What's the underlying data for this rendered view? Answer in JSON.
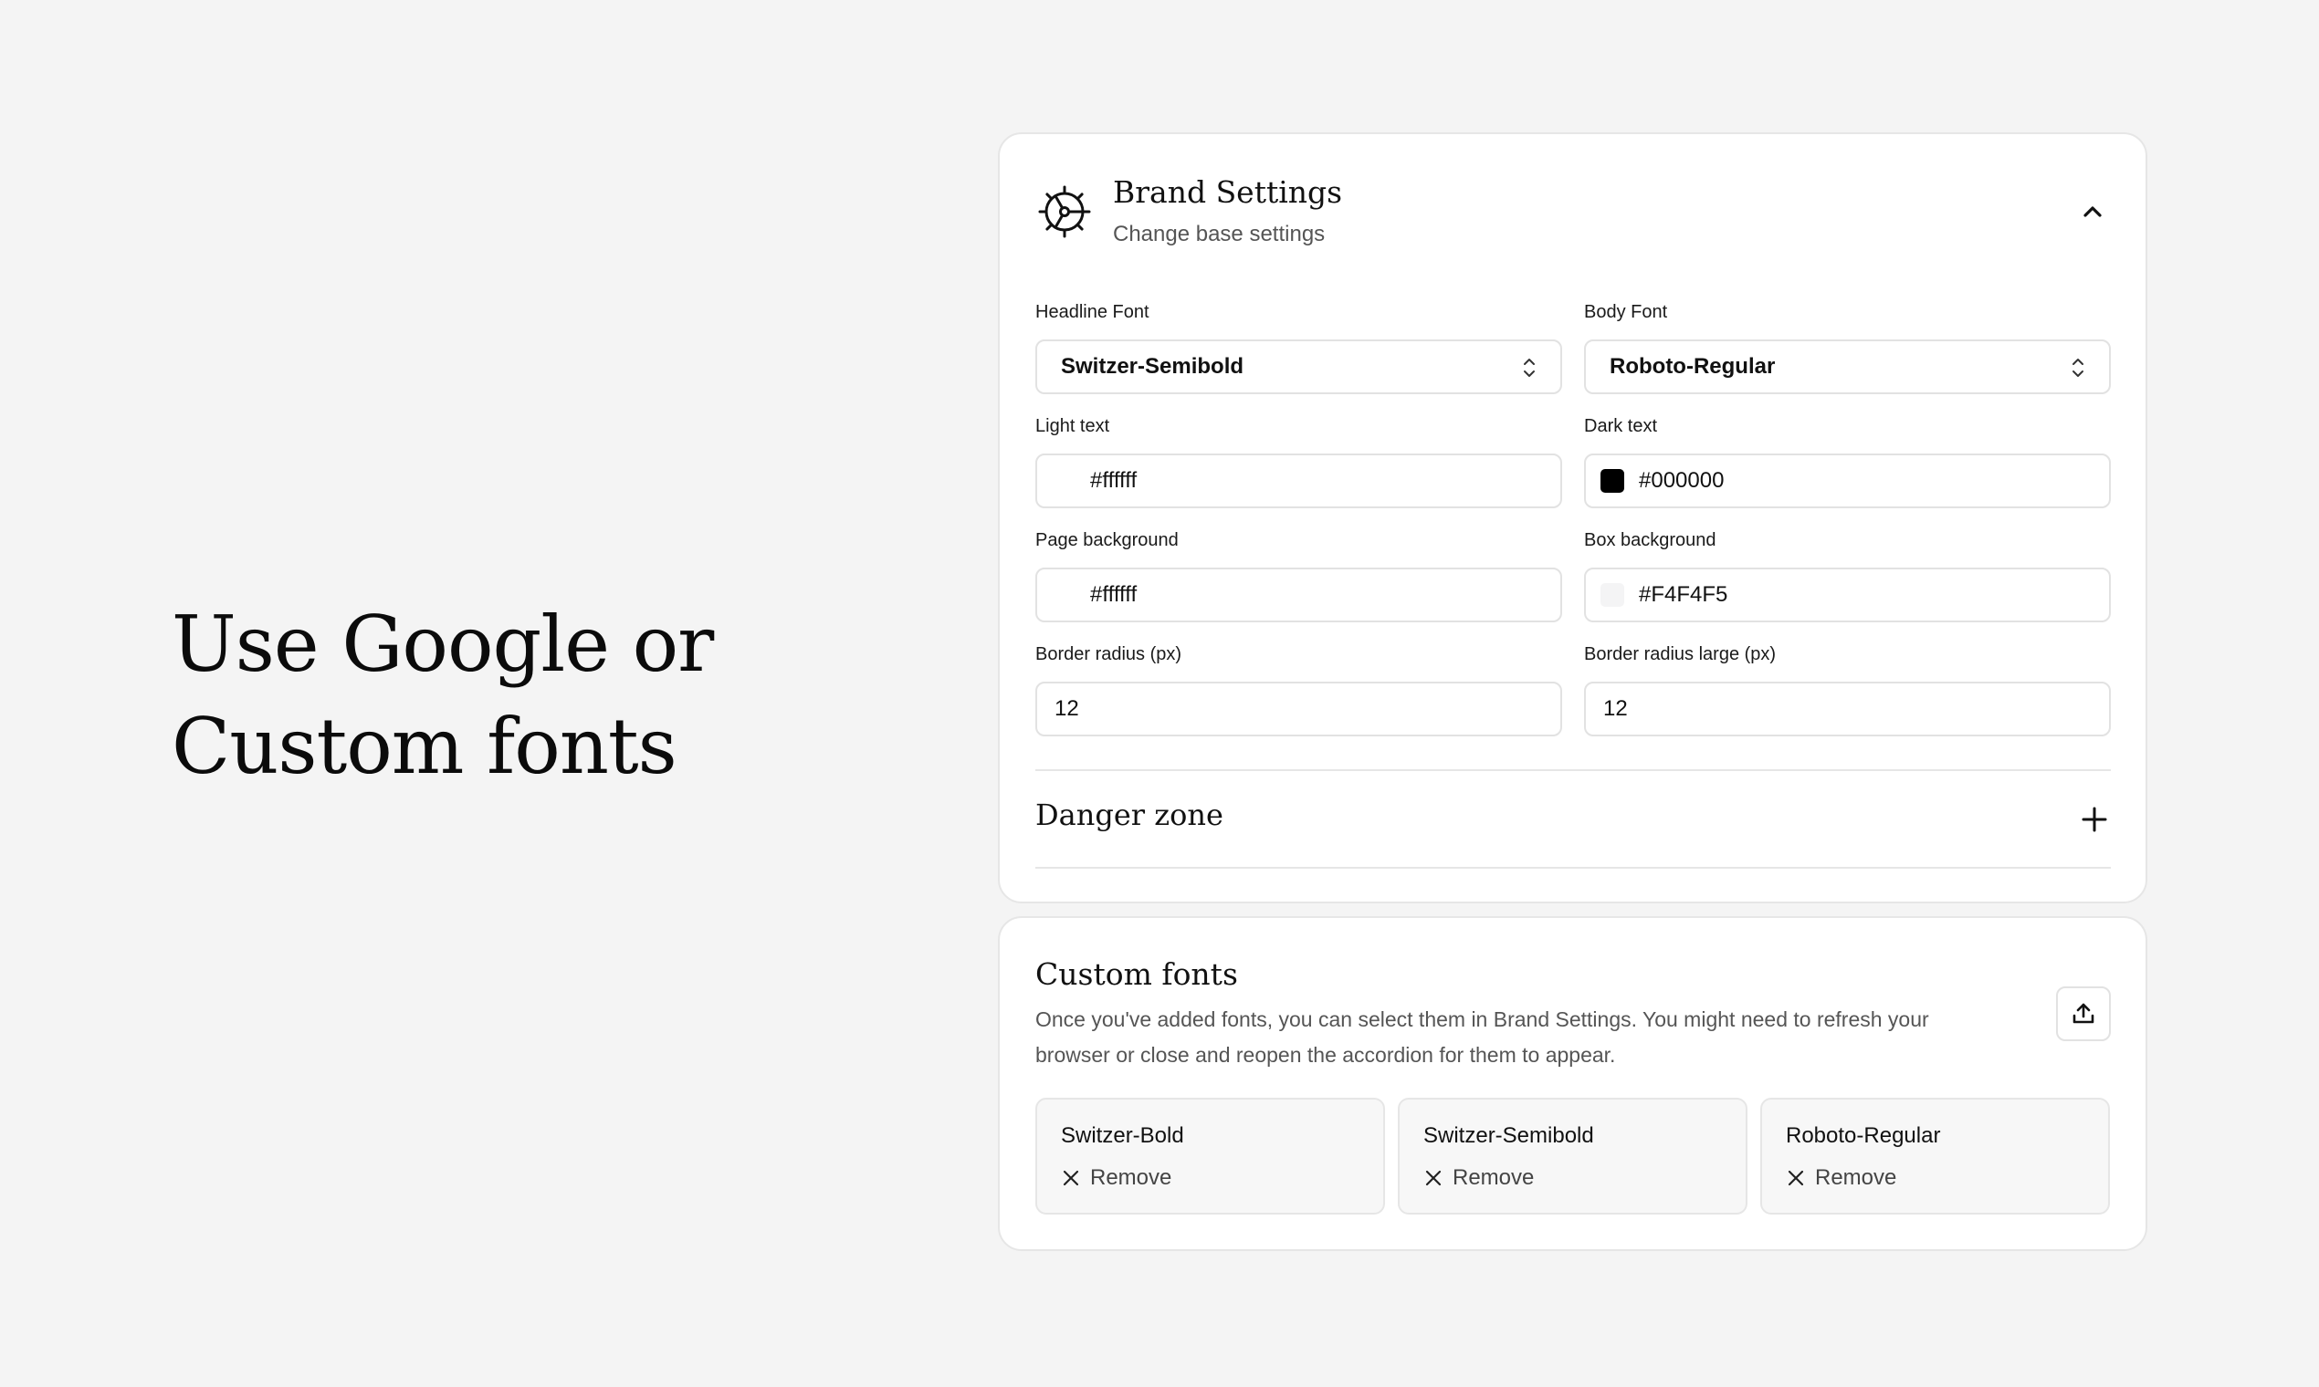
{
  "hero": {
    "line1": "Use Google or",
    "line2": "Custom fonts"
  },
  "brand_settings": {
    "title": "Brand Settings",
    "subtitle": "Change base settings",
    "icons": {
      "header": "gear-icon",
      "collapse": "chevron-up-icon"
    },
    "headline_font": {
      "label": "Headline Font",
      "value": "Switzer-Semibold"
    },
    "body_font": {
      "label": "Body Font",
      "value": "Roboto-Regular"
    },
    "light_text": {
      "label": "Light text",
      "value": "#ffffff",
      "swatch": "#ffffff"
    },
    "dark_text": {
      "label": "Dark text",
      "value": "#000000",
      "swatch": "#000000"
    },
    "page_background": {
      "label": "Page background",
      "value": "#ffffff",
      "swatch": "#ffffff"
    },
    "box_background": {
      "label": "Box background",
      "value": "#F4F4F5",
      "swatch": "#F4F4F5"
    },
    "border_radius": {
      "label": "Border radius (px)",
      "value": "12"
    },
    "border_radius_large": {
      "label": "Border radius large (px)",
      "value": "12"
    },
    "danger_zone": {
      "title": "Danger zone",
      "icon": "plus-icon"
    }
  },
  "custom_fonts": {
    "title": "Custom fonts",
    "description": "Once you've added fonts, you can select them in Brand Settings. You might need to refresh your browser or close and reopen the accordion for them to appear.",
    "upload_icon": "upload-icon",
    "remove_label": "Remove",
    "fonts": [
      "Switzer-Bold",
      "Switzer-Semibold",
      "Roboto-Regular"
    ]
  }
}
